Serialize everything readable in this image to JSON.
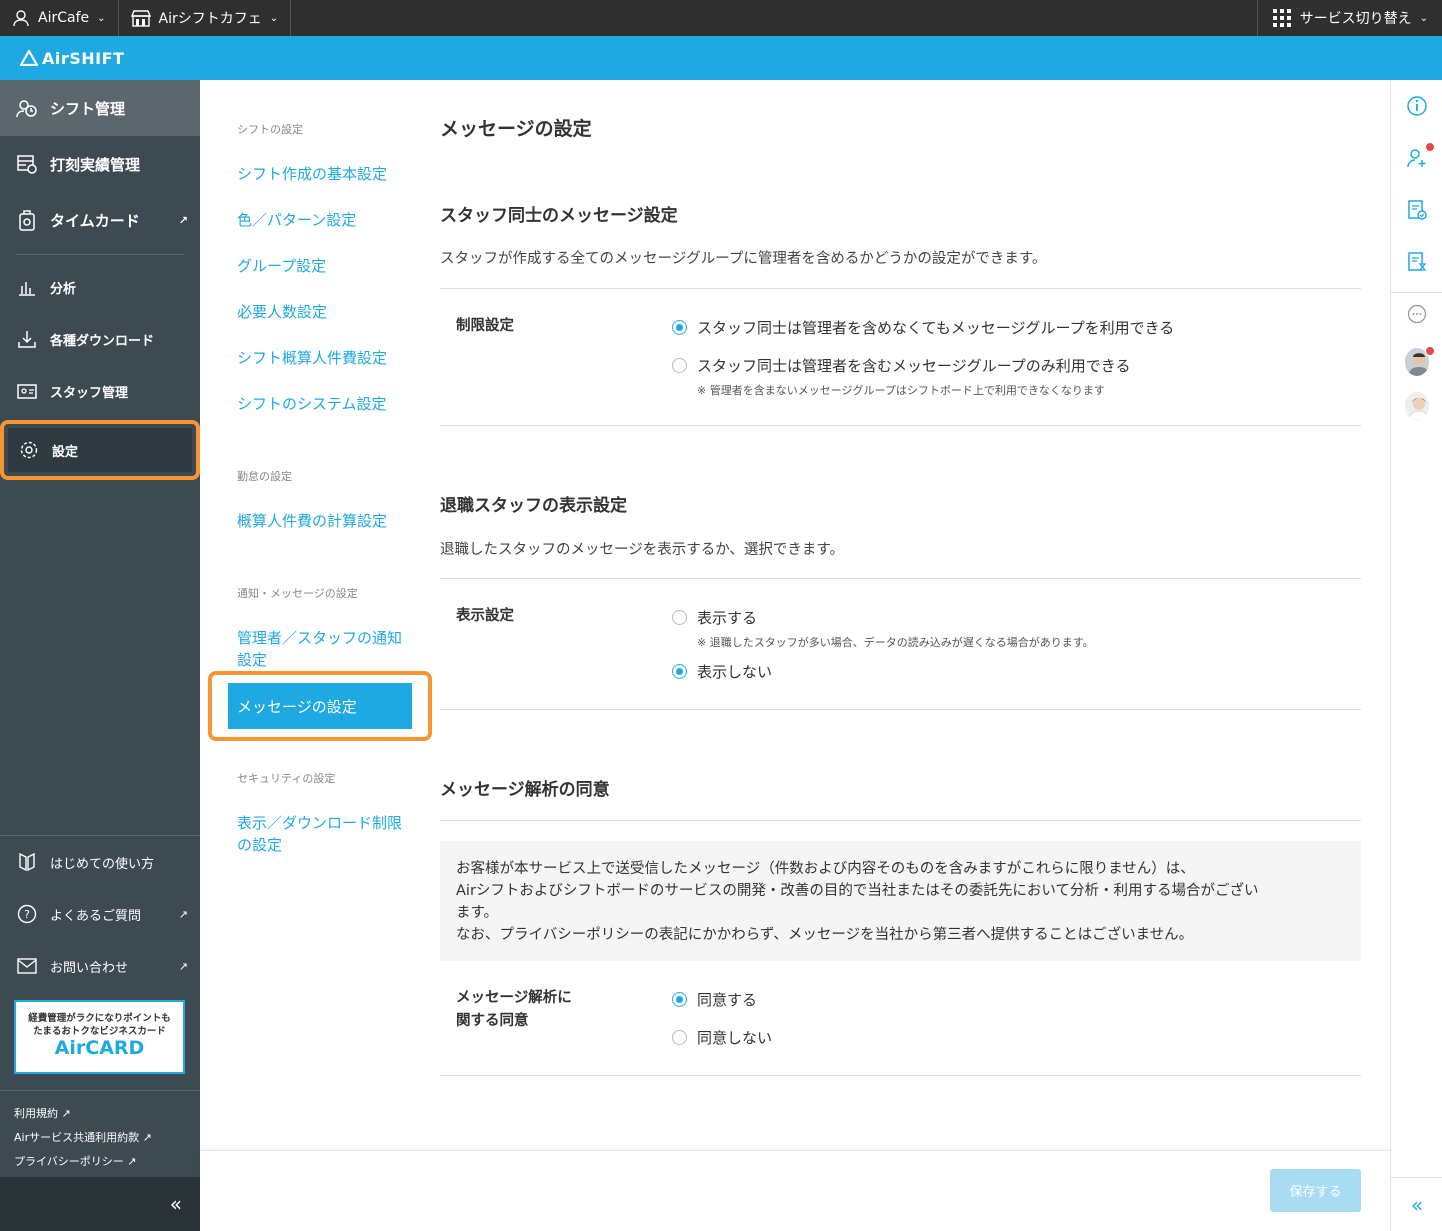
{
  "topbar": {
    "account": "AirCafe",
    "store": "Airシフトカフェ",
    "service_switch": "サービス切り替え"
  },
  "brand": {
    "name": "AirSHIFT"
  },
  "sidebar": {
    "main_items": [
      {
        "label": "シフト管理"
      },
      {
        "label": "打刻実績管理"
      },
      {
        "label": "タイムカード"
      }
    ],
    "sub_items": [
      {
        "label": "分析"
      },
      {
        "label": "各種ダウンロード"
      },
      {
        "label": "スタッフ管理"
      },
      {
        "label": "設定"
      }
    ],
    "help_items": [
      {
        "label": "はじめての使い方"
      },
      {
        "label": "よくあるご質問"
      },
      {
        "label": "お問い合わせ"
      }
    ],
    "aircard": {
      "line1": "経費管理がラクになりポイントも",
      "line2": "たまるおトクなビジネスカード",
      "logo": "AirCARD"
    },
    "legal": [
      "利用規約",
      "Airサービス共通利用約款",
      "プライバシーポリシー"
    ],
    "collapse": "«"
  },
  "subnav": {
    "groups": [
      {
        "title": "シフトの設定",
        "links": [
          "シフト作成の基本設定",
          "色／パターン設定",
          "グループ設定",
          "必要人数設定",
          "シフト概算人件費設定",
          "シフトのシステム設定"
        ]
      },
      {
        "title": "勤怠の設定",
        "links": [
          "概算人件費の計算設定"
        ]
      },
      {
        "title": "通知・メッセージの設定",
        "links": [
          "管理者／スタッフの通知設定",
          "メッセージの設定"
        ]
      },
      {
        "title": "セキュリティの設定",
        "links": [
          "表示／ダウンロード制限の設定"
        ]
      }
    ]
  },
  "main": {
    "title": "メッセージの設定",
    "section1": {
      "title": "スタッフ同士のメッセージ設定",
      "desc": "スタッフが作成する全てのメッセージグループに管理者を含めるかどうかの設定ができます。",
      "label": "制限設定",
      "options": [
        "スタッフ同士は管理者を含めなくてもメッセージグループを利用できる",
        "スタッフ同士は管理者を含むメッセージグループのみ利用できる"
      ],
      "selected": 0,
      "note": "※ 管理者を含まないメッセージグループはシフトボード上で利用できなくなります"
    },
    "section2": {
      "title": "退職スタッフの表示設定",
      "desc": "退職したスタッフのメッセージを表示するか、選択できます。",
      "label": "表示設定",
      "options": [
        "表示する",
        "表示しない"
      ],
      "selected": 1,
      "note": "※ 退職したスタッフが多い場合、データの読み込みが遅くなる場合があります。"
    },
    "section3": {
      "title": "メッセージ解析の同意",
      "consent_lines": [
        "お客様が本サービス上で送受信したメッセージ（件数および内容そのものを含みますがこれらに限りません）は、",
        "Airシフトおよびシフトボードのサービスの開発・改善の目的で当社またはその委託先において分析・利用する場合がござい",
        "ます。",
        "なお、プライバシーポリシーの表記にかかわらず、メッセージを当社から第三者へ提供することはございません。"
      ],
      "label_line1": "メッセージ解析に",
      "label_line2": "関する同意",
      "options": [
        "同意する",
        "同意しない"
      ],
      "selected": 0
    },
    "save_button": "保存する"
  },
  "rightbar": {
    "collapse": "«"
  },
  "colors": {
    "accent": "#1fa9e3",
    "highlight": "#f79633",
    "sidebar": "#3d4a52"
  }
}
